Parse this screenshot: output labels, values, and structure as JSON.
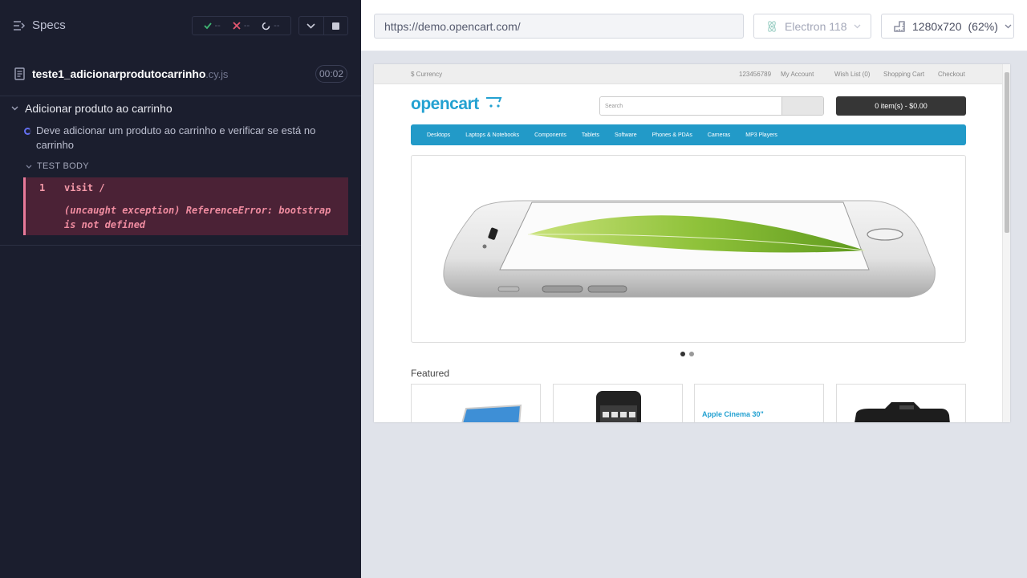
{
  "reporter": {
    "specs_label": "Specs",
    "stats": {
      "passed": "--",
      "failed": "--",
      "pending": "--"
    },
    "spec": {
      "name": "teste1_adicionarprodutocarrinho",
      "ext": ".cy.js",
      "duration": "00:02"
    },
    "suite": {
      "title": "Adicionar produto ao carrinho",
      "test_title": "Deve adicionar um produto ao carrinho e verificar se está no carrinho",
      "body_label": "TEST BODY",
      "command": {
        "number": "1",
        "name": "visit  /",
        "message": "(uncaught exception)  ReferenceError: bootstrap is not defined"
      }
    }
  },
  "app_header": {
    "url": "https://demo.opencart.com/",
    "browser": "Electron 118",
    "viewport": "1280x720",
    "viewport_scale": "(62%)"
  },
  "aut": {
    "topbar": {
      "currency": "$ Currency",
      "phone": "123456789",
      "my_account": "My Account",
      "wish_list": "Wish List (0)",
      "shopping_cart": "Shopping Cart",
      "checkout": "Checkout"
    },
    "logo": "opencart",
    "search_placeholder": "Search",
    "cart_button": "0 item(s) - $0.00",
    "menu": [
      "Desktops",
      "Laptops & Notebooks",
      "Components",
      "Tablets",
      "Software",
      "Phones & PDAs",
      "Cameras",
      "MP3 Players"
    ],
    "featured_title": "Featured",
    "products": [
      "",
      "",
      "Apple Cinema 30\"",
      ""
    ]
  },
  "colors": {
    "reporter_bg": "#1b1e2e",
    "error_bg": "#4b2236",
    "error_text": "#f59aa9",
    "opencart_blue": "#229ac8"
  }
}
